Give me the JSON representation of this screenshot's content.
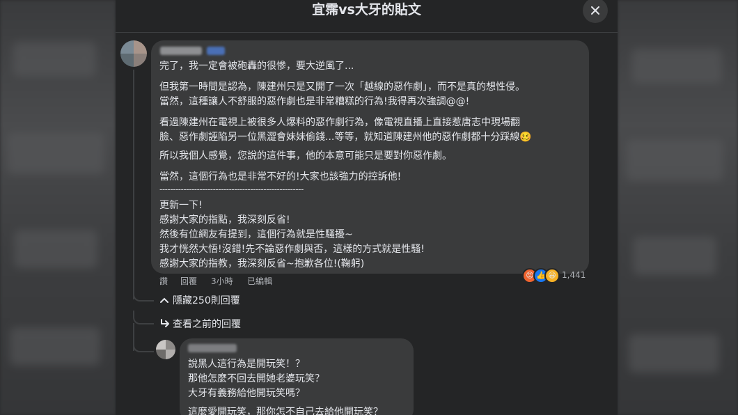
{
  "dialog": {
    "title": "宜霈vs大牙的貼文",
    "close_icon": "close-icon"
  },
  "comment1": {
    "lines": [
      "完了，我一定會被砲轟的很慘，要大逆風了...",
      "但我第一時間是認為，陳建州只是又開了一次「越線的惡作劇」，而不是真的想性侵。",
      "當然，這種讓人不舒服的惡作劇也是非常糟糕的行為!我得再次強調@@!",
      "看過陳建州在電視上被很多人爆料的惡作劇行為，像電視直播上直接惹唐志中現場翻",
      "臉、惡作劇誣陷另一位黑澀會妹妹偷錢...等等，就知道陳建州他的惡作劇都十分踩線",
      "所以我個人感覺，您說的這件事，他的本意可能只是要對你惡作劇。",
      "當然，這個行為也是非常不好的!大家也該強力的控訴他!",
      "------------------------------------------------------",
      "更新一下!",
      "感謝大家的指點，我深刻反省!",
      "然後有位網友有提到，這個行為就是性騷擾~",
      "我才恍然大悟!沒錯!先不論惡作劇與否，這樣的方式就是性騷!",
      "感謝大家的指教，我深刻反省~抱歉各位!(鞠躬)"
    ],
    "emoji": "🥴",
    "actions": {
      "like": "讚",
      "reply": "回覆",
      "time": "3小時",
      "edited": "已編輯"
    },
    "reactions": {
      "icons": [
        "angry",
        "like",
        "haha"
      ],
      "count": "1,441"
    }
  },
  "thread": {
    "hide_replies": "隱藏250則回覆",
    "view_previous": "查看之前的回覆"
  },
  "comment2": {
    "lines": [
      "說黑人這行為是開玩笑！？",
      "那他怎麼不回去開她老婆玩笑？",
      "大牙有義務給他開玩笑嗎？",
      "這麼愛開玩笑，那你怎不自己去給他開玩笑？"
    ]
  },
  "colors": {
    "dialog_bg": "#242526",
    "bubble_bg": "#3a3b3c",
    "text": "#e4e6eb",
    "secondary_text": "#b0b3b8",
    "angry": "#f0642f",
    "like": "#1877f2",
    "haha": "#f7b125"
  }
}
